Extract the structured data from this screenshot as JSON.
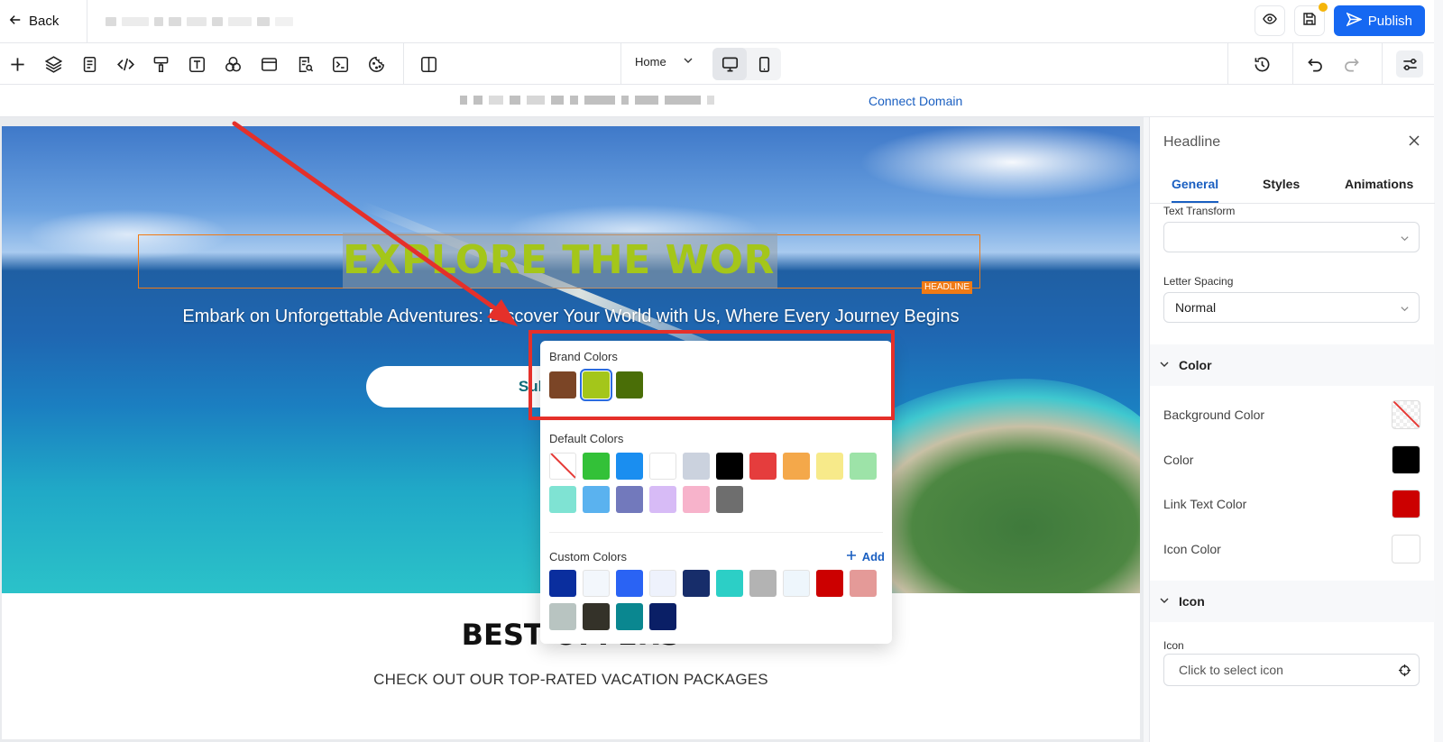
{
  "topbar": {
    "back_label": "Back",
    "publish_label": "Publish"
  },
  "toolbar": {
    "page_selector": "Home"
  },
  "domain_bar": {
    "connect_label": "Connect Domain"
  },
  "hero": {
    "headline": "EXPLORE THE WORLD",
    "headline_tag": "HEADLINE",
    "subtitle": "Embark on Unforgettable Adventures: Discover Your World with Us, Where Every Journey Begins",
    "button_label": "Subscribe"
  },
  "offers": {
    "title": "BEST OFFERS",
    "subtitle": "CHECK OUT OUR TOP-RATED VACATION PACKAGES"
  },
  "color_picker": {
    "brand_title": "Brand Colors",
    "default_title": "Default Colors",
    "custom_title": "Custom Colors",
    "add_label": "Add",
    "brand_colors": [
      "#7b4526",
      "#a4c61a",
      "#4a6e07"
    ],
    "selected_brand_color": "#a4c61a",
    "default_colors": [
      "transparent",
      "#33c138",
      "#1a8ef0",
      "#ffffff",
      "#cbd2de",
      "#000000",
      "#e53d3d",
      "#f4a84a",
      "#f7ea8a",
      "#9de3a8",
      "#7fe3d3",
      "#5ab2ef",
      "#7279bc",
      "#d7bbf6",
      "#f7b3cb",
      "#6e6e6e"
    ],
    "custom_colors": [
      "#0a2e9e",
      "#f3f7fc",
      "#2a63f4",
      "#eef2fc",
      "#172d6a",
      "#2ccfc6",
      "#b3b3b3",
      "#eef6fc",
      "#cc0000",
      "#e49a98",
      "#b8c4c1",
      "#343229",
      "#0a8790",
      "#0a1f66"
    ]
  },
  "panel": {
    "title": "Headline",
    "tabs": [
      "General",
      "Styles",
      "Animations"
    ],
    "text_transform_label": "Text Transform",
    "text_transform_value": "",
    "letter_spacing_label": "Letter Spacing",
    "letter_spacing_value": "Normal",
    "color_section": "Color",
    "background_color_label": "Background Color",
    "color_label": "Color",
    "link_text_color_label": "Link Text Color",
    "icon_color_label": "Icon Color",
    "color_value": "#000000",
    "link_text_color_value": "#cc0000",
    "icon_color_value": "#ffffff",
    "icon_section": "Icon",
    "icon_field_label": "Icon",
    "icon_placeholder": "Click to select icon"
  },
  "accent_color": "#1668f2",
  "annotation_color": "#e5302a"
}
